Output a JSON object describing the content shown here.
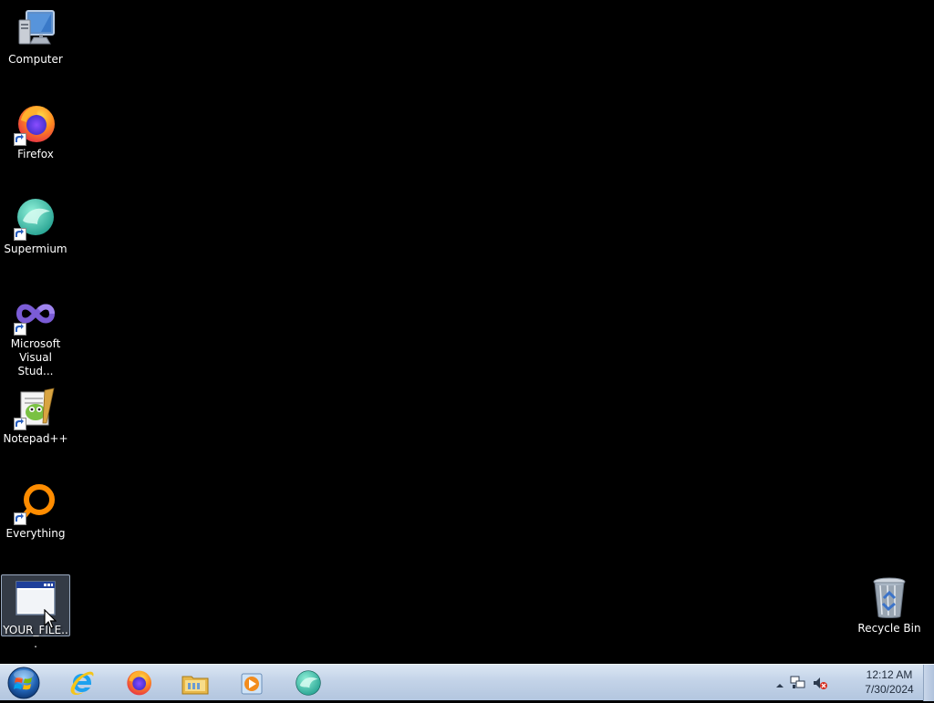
{
  "desktop": {
    "icons": [
      {
        "label": "Computer",
        "icon": "computer-icon"
      },
      {
        "label": "Firefox",
        "icon": "firefox-icon"
      },
      {
        "label": "Supermium",
        "icon": "supermium-icon"
      },
      {
        "label": "Microsoft Visual Stud...",
        "icon": "visual-studio-icon"
      },
      {
        "label": "Notepad++",
        "icon": "notepad-plus-plus-icon"
      },
      {
        "label": "Everything",
        "icon": "everything-icon"
      },
      {
        "label": "YOUR_FILE...",
        "icon": "window-file-icon"
      },
      {
        "label": "Recycle Bin",
        "icon": "recycle-bin-icon"
      }
    ]
  },
  "taskbar": {
    "start_icon": "windows-orb-icon",
    "pinned": [
      {
        "icon": "internet-explorer-icon"
      },
      {
        "icon": "firefox-icon"
      },
      {
        "icon": "file-explorer-icon"
      },
      {
        "icon": "media-player-icon"
      },
      {
        "icon": "supermium-icon"
      }
    ],
    "tray": {
      "icons": [
        "show-hidden-icons-arrow",
        "network-icon",
        "volume-muted-icon"
      ],
      "time": "12:12 AM",
      "date": "7/30/2024"
    }
  },
  "colors": {
    "desktop_background": "#000000",
    "taskbar": "#c3d3e8",
    "selection": "#9aaac0"
  }
}
